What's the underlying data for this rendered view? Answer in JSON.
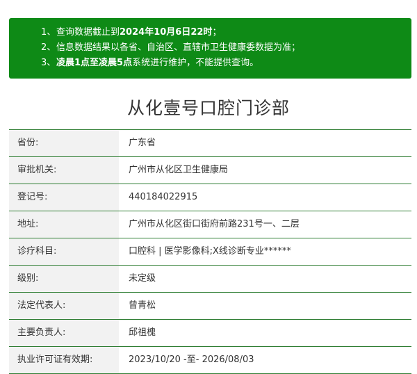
{
  "notice": {
    "items": [
      {
        "num": "1、",
        "pre": "查询数据截止到",
        "strong": "2024年10月6日22时",
        "post": "；"
      },
      {
        "num": "2、",
        "pre": "信息数据结果以各省、自治区、直辖市卫生健康委数据为准；",
        "strong": "",
        "post": ""
      },
      {
        "num": "3、",
        "pre": "",
        "strong": "凌晨1点至凌晨5点",
        "post": "系统进行维护，不能提供查询。"
      }
    ]
  },
  "title": "从化壹号口腔门诊部",
  "rows": [
    {
      "label": "省份:",
      "value": "广东省"
    },
    {
      "label": "审批机关:",
      "value": "广州市从化区卫生健康局"
    },
    {
      "label": "登记号:",
      "value": "440184022915"
    },
    {
      "label": "地址:",
      "value": "广州市从化区街口街府前路231号一、二层"
    },
    {
      "label": "诊疗科目:",
      "value": "口腔科 | 医学影像科;X线诊断专业******"
    },
    {
      "label": "级别:",
      "value": "未定级"
    },
    {
      "label": "法定代表人:",
      "value": "曾青松"
    },
    {
      "label": "主要负责人:",
      "value": "邱祖槐"
    },
    {
      "label": "执业许可证有效期:",
      "value": "2023/10/20 -至- 2026/08/03"
    }
  ]
}
